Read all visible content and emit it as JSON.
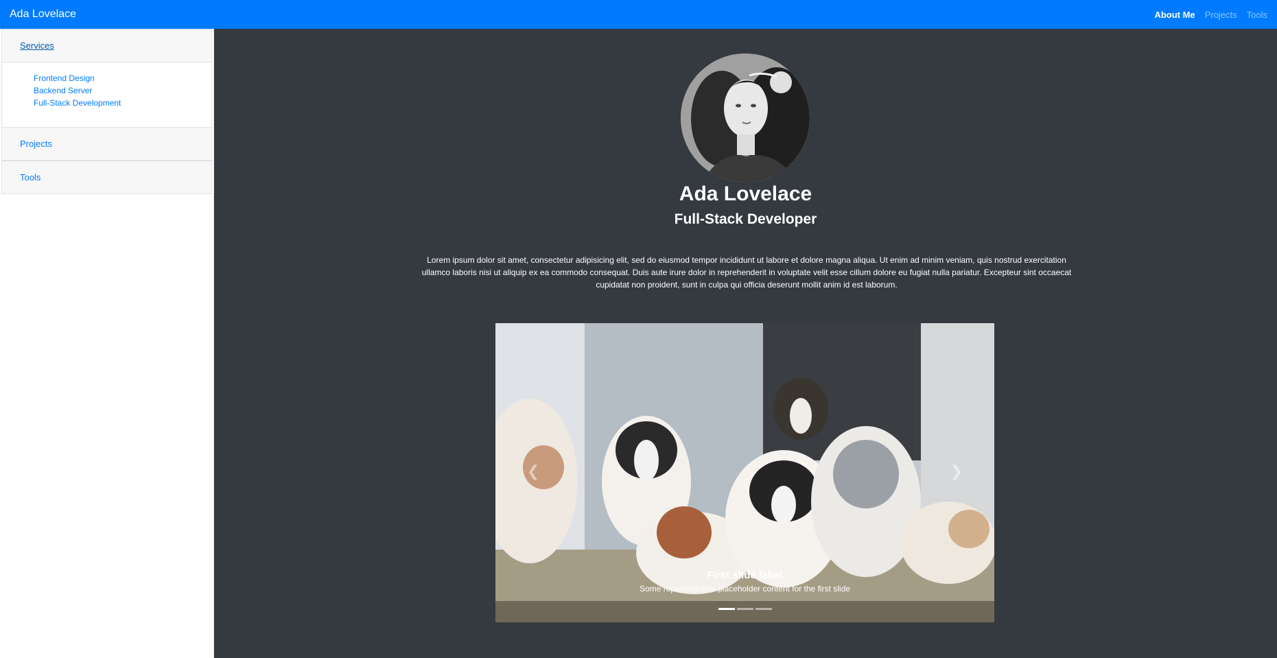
{
  "navbar": {
    "brand": "Ada Lovelace",
    "links": [
      {
        "label": "About Me",
        "active": true
      },
      {
        "label": "Projects",
        "active": false
      },
      {
        "label": "Tools",
        "active": false
      }
    ]
  },
  "sidebar": {
    "sections": [
      {
        "label": "Services",
        "expanded": true,
        "items": [
          "Frontend Design",
          "Backend Server",
          "Full-Stack Development"
        ]
      },
      {
        "label": "Projects",
        "expanded": false
      },
      {
        "label": "Tools",
        "expanded": false
      }
    ]
  },
  "profile": {
    "name": "Ada Lovelace",
    "role": "Full-Stack Developer",
    "bio": "Lorem ipsum dolor sit amet, consectetur adipisicing elit, sed do eiusmod tempor incididunt ut labore et dolore magna aliqua. Ut enim ad minim veniam, quis nostrud exercitation ullamco laboris nisi ut aliquip ex ea commodo consequat. Duis aute irure dolor in reprehenderit in voluptate velit esse cillum dolore eu fugiat nulla pariatur. Excepteur sint occaecat cupidatat non proident, sunt in culpa qui officia deserunt mollit anim id est laborum."
  },
  "carousel": {
    "active_index": 0,
    "slide_count": 3,
    "caption_title": "First slide label",
    "caption_text": "Some representative placeholder content for the first slide"
  },
  "colors": {
    "navbar": "#007bff",
    "main_bg": "#343a40",
    "link": "#007bff"
  }
}
